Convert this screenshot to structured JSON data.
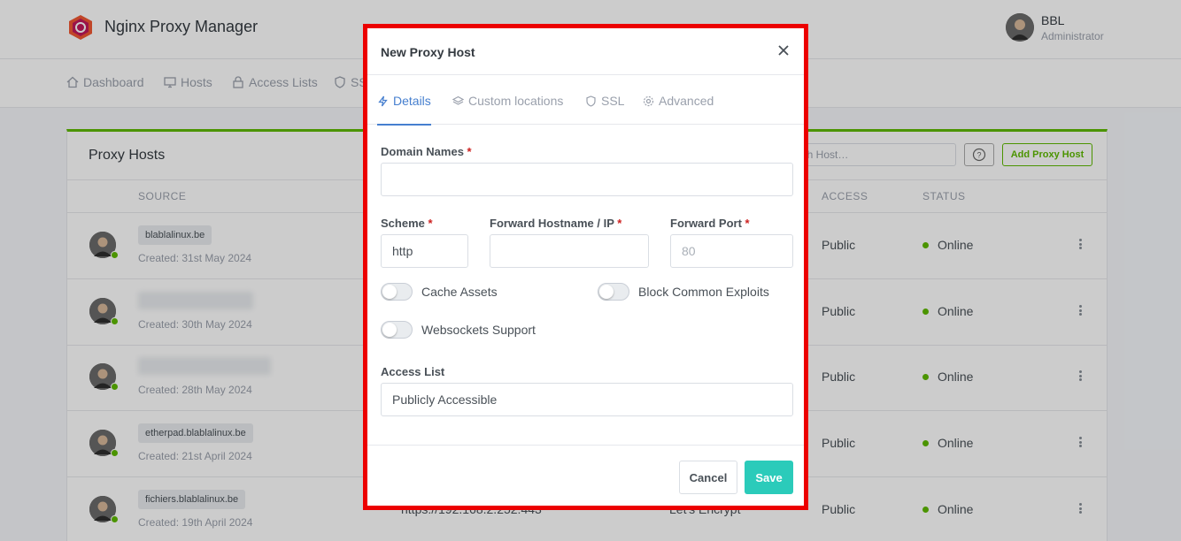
{
  "header": {
    "app_title": "Nginx Proxy Manager",
    "user_name": "BBL",
    "user_role": "Administrator"
  },
  "nav": {
    "items": [
      {
        "label": "Dashboard",
        "icon": "home-icon"
      },
      {
        "label": "Hosts",
        "icon": "monitor-icon"
      },
      {
        "label": "Access Lists",
        "icon": "lock-icon"
      },
      {
        "label": "SS",
        "icon": "shield-icon"
      }
    ]
  },
  "card": {
    "title": "Proxy Hosts",
    "search_placeholder": "arch Host…",
    "add_button": "Add Proxy Host",
    "columns": {
      "source": "SOURCE",
      "access": "ACCESS",
      "status": "STATUS"
    },
    "rows": [
      {
        "domain": "blablalinux.be",
        "created": "Created: 31st May 2024",
        "access": "Public",
        "status": "Online",
        "blurred": false
      },
      {
        "domain": "(blurred)",
        "created": "Created: 30th May 2024",
        "access": "Public",
        "status": "Online",
        "blurred": true
      },
      {
        "domain": "(blurred)",
        "created": "Created: 28th May 2024",
        "access": "Public",
        "status": "Online",
        "blurred": true
      },
      {
        "domain": "etherpad.blablalinux.be",
        "created": "Created: 21st April 2024",
        "access": "Public",
        "status": "Online",
        "blurred": false
      },
      {
        "domain": "fichiers.blablalinux.be",
        "created": "Created: 19th April 2024",
        "access": "Public",
        "status": "Online",
        "blurred": false,
        "destination": "https://192.168.2.252:443",
        "ssl": "Let's Encrypt"
      }
    ]
  },
  "modal": {
    "title": "New Proxy Host",
    "tabs": [
      {
        "label": "Details",
        "icon": "bolt-icon",
        "active": true
      },
      {
        "label": "Custom locations",
        "icon": "layers-icon",
        "active": false
      },
      {
        "label": "SSL",
        "icon": "shield-icon",
        "active": false
      },
      {
        "label": "Advanced",
        "icon": "gear-icon",
        "active": false
      }
    ],
    "domain_names_label": "Domain Names",
    "domain_names_value": "",
    "scheme_label": "Scheme",
    "scheme_value": "http",
    "forward_host_label": "Forward Hostname / IP",
    "forward_host_value": "",
    "forward_port_label": "Forward Port",
    "forward_port_placeholder": "80",
    "required_mark": "*",
    "toggles": {
      "cache_assets": "Cache Assets",
      "block_exploits": "Block Common Exploits",
      "websockets": "Websockets Support"
    },
    "access_list_label": "Access List",
    "access_list_value": "Publicly Accessible",
    "cancel": "Cancel",
    "save": "Save"
  },
  "colors": {
    "accent_green": "#5eba00",
    "tab_blue": "#467fcf",
    "save_teal": "#2bcbba",
    "highlight_red": "#ec0000"
  }
}
